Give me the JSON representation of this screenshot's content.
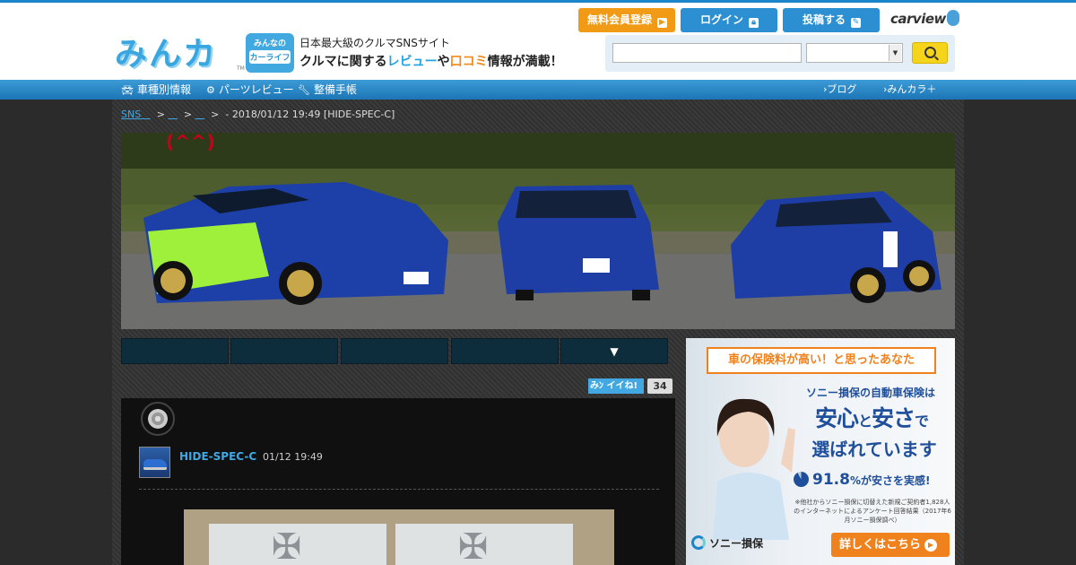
{
  "header": {
    "logo_text": "みんカラ",
    "logo_tm": "TM",
    "carlife_top": "みんなの",
    "carlife_main": "カーライフ",
    "tagline_1": "日本最大級のクルマSNSサイト",
    "tagline_2_a": "クルマに関する",
    "tagline_2_review": "レビュー",
    "tagline_2_b": "や",
    "tagline_2_kuchikomi": "口コミ",
    "tagline_2_c": "情報が満載！",
    "btn_register": "無料会員登録",
    "btn_login": "ログイン",
    "btn_post": "投稿する",
    "carview_text": "carview",
    "search_value": "",
    "search_placeholder": "",
    "select_value": ""
  },
  "nav": {
    "left": [
      {
        "label": "車種別情報",
        "icon": "car-icon"
      },
      {
        "label": "パーツレビュー",
        "icon": "gear-icon"
      },
      {
        "label": "整備手帳",
        "icon": "wrench-icon"
      }
    ],
    "right": [
      {
        "label": "ブログ"
      },
      {
        "label": "みんカラ＋"
      }
    ]
  },
  "breadcrumb": {
    "sns": "SNS",
    "link2": "",
    "link3": "",
    "current": "- 2018/01/12 19:49 [HIDE-SPEC-C]"
  },
  "banner": {
    "title": "(^^)"
  },
  "tabs": [
    {
      "label": ""
    },
    {
      "label": ""
    },
    {
      "label": ""
    },
    {
      "label": ""
    },
    {
      "label": "▼"
    }
  ],
  "like": {
    "label": "イイね!",
    "count": "34"
  },
  "post": {
    "user": "HIDE-SPEC-C",
    "date": "01/12 19:49"
  },
  "ad": {
    "headline": "車の保険料が高い！と思ったあなた",
    "line1": "ソニー損保の自動車保険は",
    "line2_a": "安心",
    "line2_small": "と",
    "line2_b": "安さ",
    "line2_c": "で",
    "line3": "選ばれています",
    "stat_value": "91.8",
    "stat_text": "%が安さを実感!",
    "note": "※他社からソニー損保に切替えた新規ご契約者1,828人のインターネットによるアンケート回答結果（2017年6月ソニー損保調べ）",
    "brand": "ソニー損保",
    "cta": "詳しくはこちら"
  },
  "colors": {
    "accent_blue": "#1a86c8",
    "orange": "#f19a16",
    "sony_blue": "#1f4f9b"
  }
}
